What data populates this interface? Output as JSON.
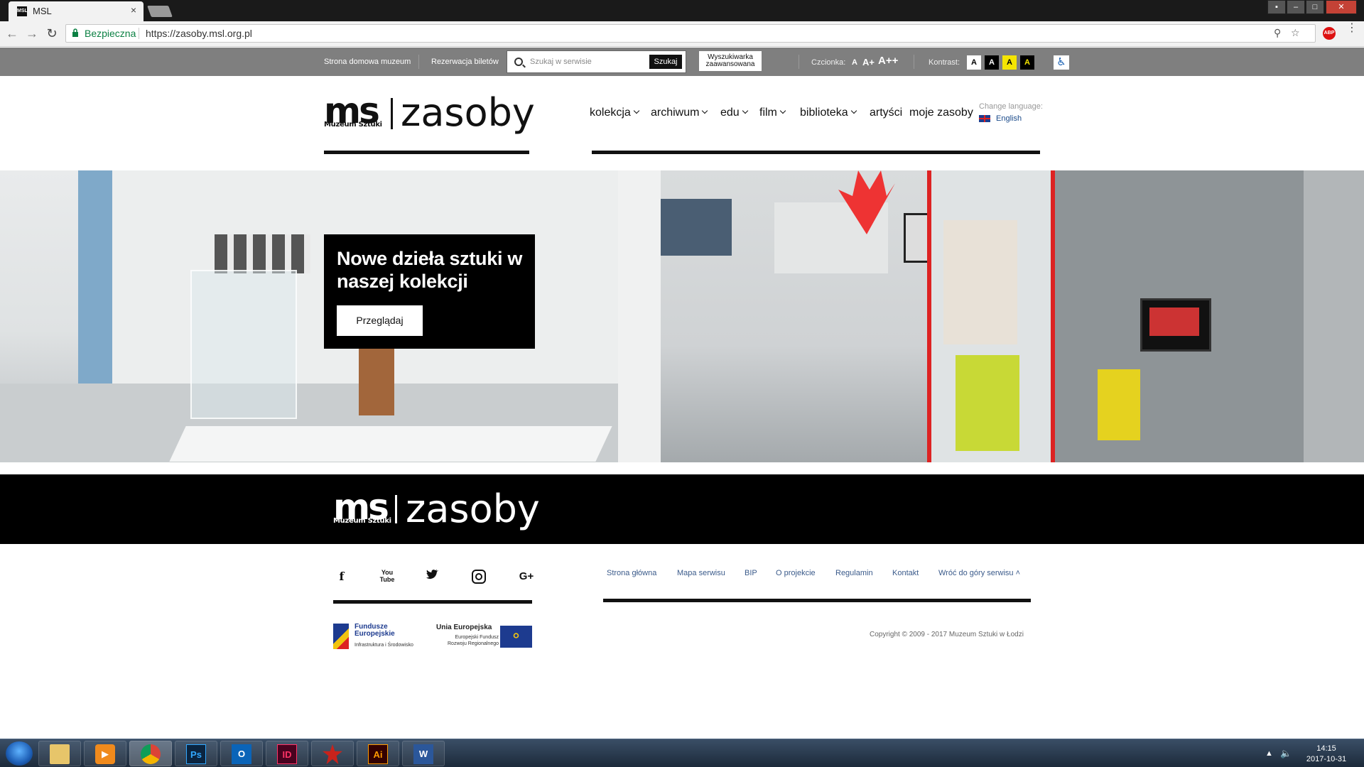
{
  "browser": {
    "tab_title": "MSL",
    "tab_favicon": "MSL",
    "tab_close": "×",
    "secure_label": "Bezpieczna",
    "url": "https://zasoby.msl.org.pl",
    "abp_label": "ABP"
  },
  "site_bar": {
    "home_link": "Strona domowa muzeum",
    "tickets_link": "Rezerwacja biletów",
    "search_placeholder": "Szukaj w serwisie",
    "search_button": "Szukaj",
    "advanced_search": "Wyszukiwarka zaawansowana",
    "font_label": "Czcionka:",
    "font_sizes": [
      "A",
      "A+",
      "A++"
    ],
    "contrast_label": "Kontrast:",
    "contrast_options": [
      "A",
      "A",
      "A",
      "A"
    ]
  },
  "header": {
    "logo_ms": "ms",
    "logo_museum": "Muzeum Sztuki",
    "logo_zasoby": "zasoby",
    "nav": {
      "kolekcja": "kolekcja",
      "archiwum": "archiwum",
      "edu": "edu",
      "film": "film",
      "biblioteka": "biblioteka",
      "artysci": "artyści",
      "moje_zasoby": "moje zasoby"
    },
    "change_language_label": "Change language:",
    "language": "English"
  },
  "hero": {
    "title": "Nowe dzieła sztuki w naszej kolekcji",
    "button": "Przeglądaj"
  },
  "footer": {
    "logo_ms": "ms",
    "logo_museum": "Muzeum Sztuki",
    "logo_zasoby": "zasoby",
    "social": [
      "facebook-icon",
      "youtube-icon",
      "twitter-icon",
      "instagram-icon",
      "google-plus-icon"
    ],
    "links": {
      "home": "Strona główna",
      "sitemap": "Mapa serwisu",
      "bip": "BIP",
      "about": "O projekcie",
      "terms": "Regulamin",
      "contact": "Kontakt",
      "back_to_top": "Wróć do góry serwisu ˄"
    },
    "eu_funds_title": "Fundusze Europejskie",
    "eu_funds_sub": "Infrastruktura i Środowisko",
    "eu_union_title": "Unia Europejska",
    "eu_union_sub": "Europejski Fundusz Rozwoju Regionalnego",
    "copyright": "Copyright © 2009 - 2017 Muzeum Sztuki w Łodzi"
  },
  "taskbar": {
    "apps": [
      {
        "name": "explorer",
        "label": ""
      },
      {
        "name": "media-player",
        "label": "▶"
      },
      {
        "name": "chrome",
        "label": ""
      },
      {
        "name": "photoshop",
        "label": "Ps"
      },
      {
        "name": "outlook",
        "label": "O"
      },
      {
        "name": "indesign",
        "label": "ID"
      },
      {
        "name": "app-red",
        "label": ""
      },
      {
        "name": "illustrator",
        "label": "Ai"
      },
      {
        "name": "word",
        "label": "W"
      }
    ],
    "time": "14:15",
    "date": "2017-10-31"
  },
  "colors": {
    "site_bar_bg": "#7f7f7f",
    "accent_black": "#000000",
    "link_blue": "#3a5a8a",
    "secure_green": "#0b8043"
  }
}
